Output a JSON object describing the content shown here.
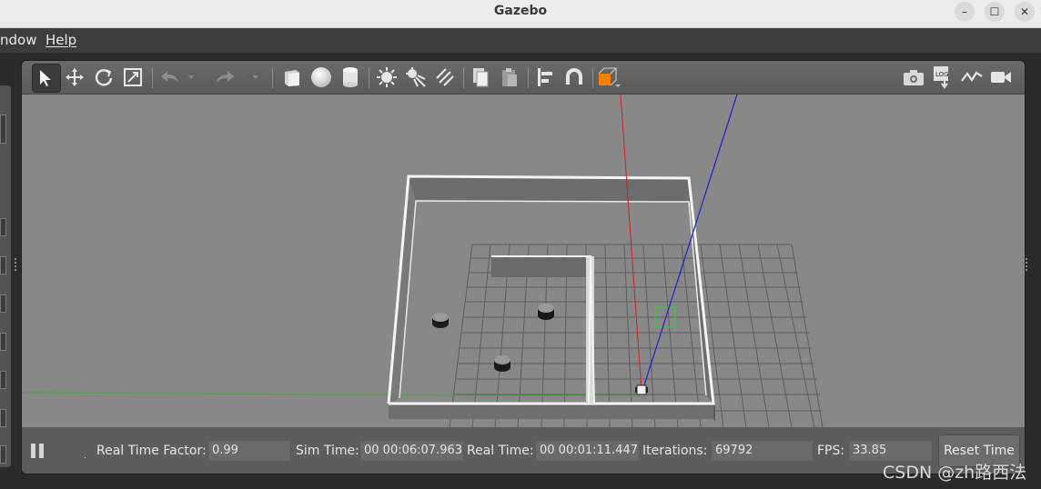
{
  "window": {
    "title": "Gazebo"
  },
  "menubar": {
    "items": [
      "ndow",
      "Help"
    ]
  },
  "toolbar": {
    "tools": [
      "select-icon",
      "translate-icon",
      "rotate-icon",
      "scale-icon",
      "undo-icon",
      "redo-icon",
      "box-icon",
      "sphere-icon",
      "cylinder-icon",
      "point-light-icon",
      "spot-light-icon",
      "directional-light-icon",
      "copy-icon",
      "paste-icon",
      "align-icon",
      "magnet-icon",
      "view-angle-icon",
      "screenshot-icon",
      "log-icon",
      "plot-icon",
      "video-icon"
    ],
    "accent": "#ff7f00"
  },
  "status": {
    "real_time_factor_label": "Real Time Factor:",
    "real_time_factor": "0.99",
    "sim_time_label": "Sim Time:",
    "sim_time": "00 00:06:07.963",
    "real_time_label": "Real Time:",
    "real_time": "00 00:01:11.447",
    "iterations_label": "Iterations:",
    "iterations": "69792",
    "fps_label": "FPS:",
    "fps": "33.85",
    "reset_label": "Reset Time"
  },
  "watermark": "CSDN @zh路西法"
}
